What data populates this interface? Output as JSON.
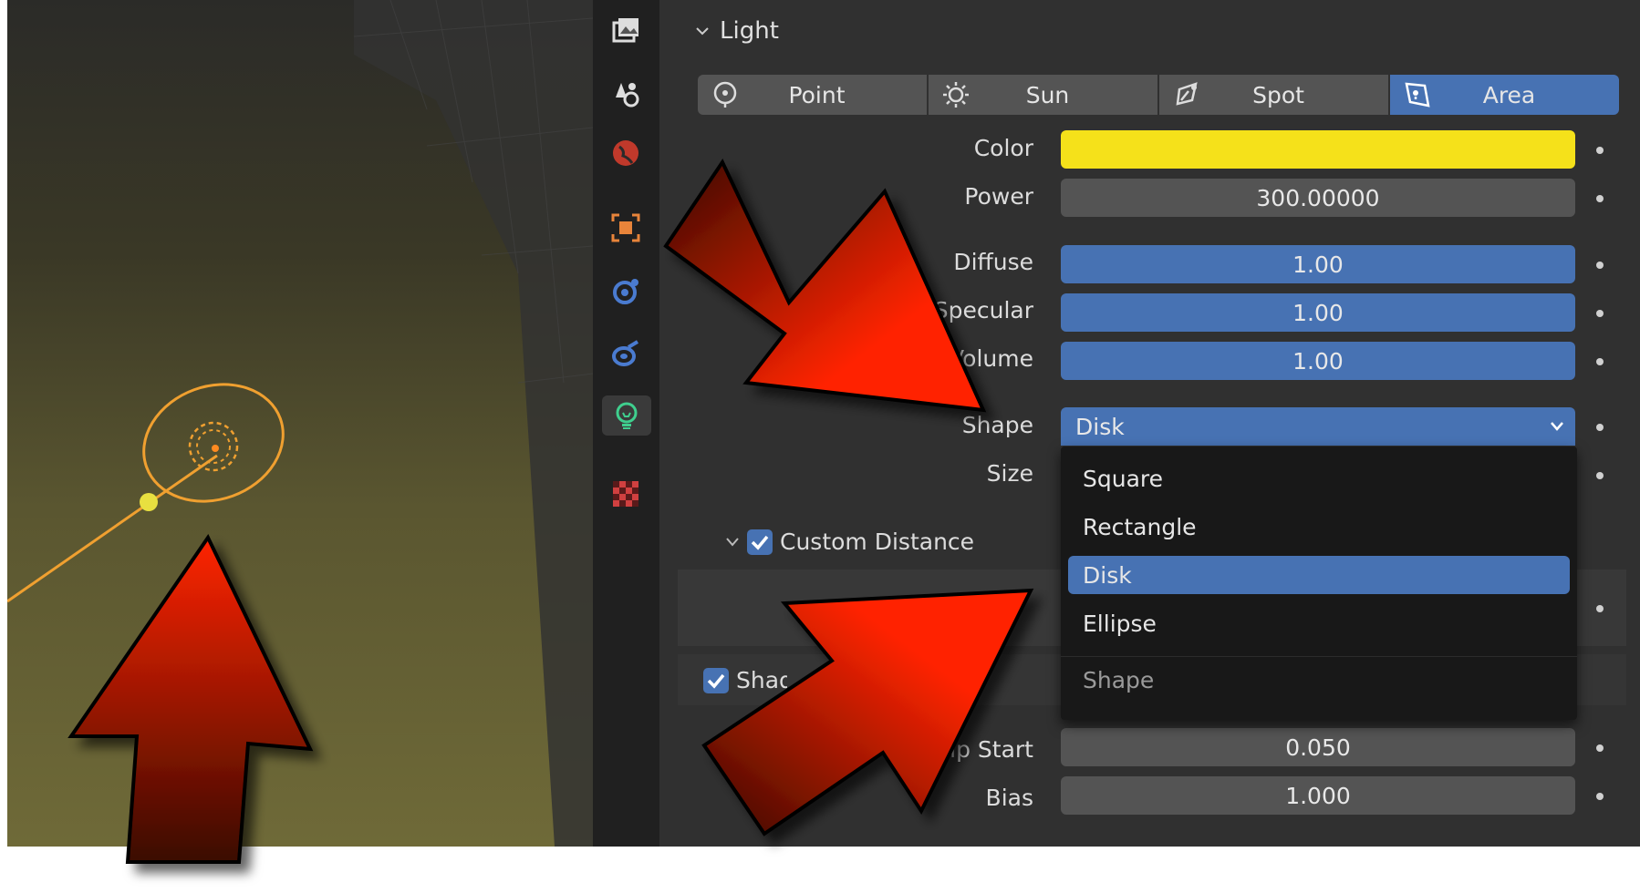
{
  "panel": {
    "section_title": "Light",
    "light_types": [
      {
        "label": "Point",
        "icon": "point-light-icon"
      },
      {
        "label": "Sun",
        "icon": "sun-light-icon"
      },
      {
        "label": "Spot",
        "icon": "spot-light-icon"
      },
      {
        "label": "Area",
        "icon": "area-light-icon"
      }
    ],
    "active_light_type": "Area",
    "color_label": "Color",
    "color_value": "#f5e11a",
    "power_label": "Power",
    "power_value": "300.00000",
    "diffuse_label": "Diffuse",
    "diffuse_value": "1.00",
    "specular_label": "Specular",
    "specular_value": "1.00",
    "volume_label": "Volume",
    "volume_value": "1.00",
    "shape_label": "Shape",
    "shape_value": "Disk",
    "size_label": "Size",
    "custom_distance_label": "Custom Distance",
    "shadow_section_label": "Shadow",
    "clip_start_label": "Clip Start",
    "clip_start_value": "0.050",
    "bias_label": "Bias",
    "bias_value": "1.000"
  },
  "dropdown": {
    "options": [
      "Square",
      "Rectangle",
      "Disk",
      "Ellipse"
    ],
    "selected": "Disk",
    "footer": "Shape"
  },
  "tabs": [
    "render-icon",
    "scene-icon",
    "world-icon",
    "object-icon",
    "physics-icon",
    "constraints-icon",
    "light-data-icon",
    "texture-icon"
  ],
  "colors": {
    "accent_blue": "#4772b3",
    "light_orange": "#f0a030",
    "arrow_red": "#e02000"
  }
}
